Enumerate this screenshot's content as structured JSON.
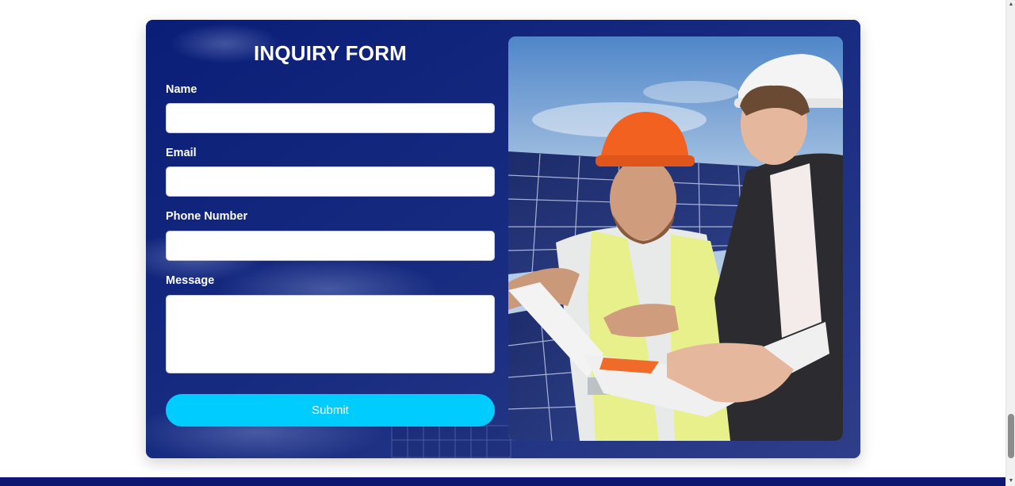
{
  "form": {
    "title": "INQUIRY FORM",
    "name_label": "Name",
    "email_label": "Email",
    "phone_label": "Phone Number",
    "message_label": "Message",
    "name_value": "",
    "email_value": "",
    "phone_value": "",
    "message_value": "",
    "submit_label": "Submit"
  },
  "colors": {
    "card_background": "#14287c",
    "submit_button": "#00ccff",
    "footer": "#0d1770"
  },
  "image": {
    "description_icon": "solar-engineers-photo"
  },
  "scrollbar": {
    "up_icon": "chevron-up-icon",
    "down_icon": "chevron-down-icon"
  }
}
